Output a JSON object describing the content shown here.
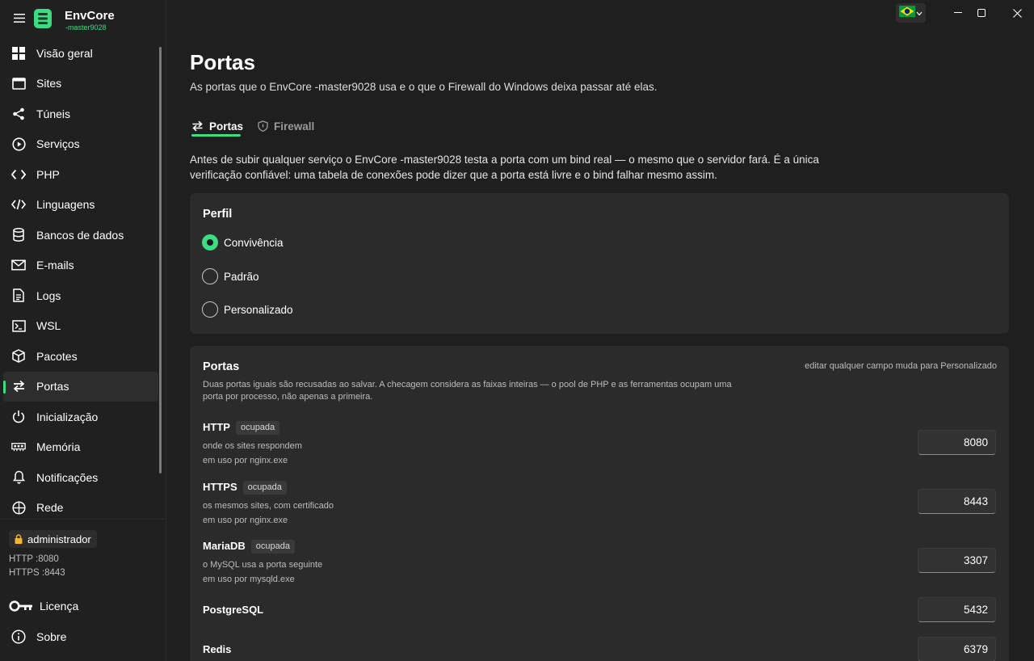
{
  "app": {
    "title": "EnvCore",
    "subtitle": "-master9028",
    "accent": "#3ddc84"
  },
  "sidebar": {
    "items": [
      {
        "label": "Visão geral",
        "icon": "grid-icon"
      },
      {
        "label": "Sites",
        "icon": "browser-window-icon"
      },
      {
        "label": "Túneis",
        "icon": "share-icon"
      },
      {
        "label": "Serviços",
        "icon": "play-circle-icon"
      },
      {
        "label": "PHP",
        "icon": "code-brackets-icon"
      },
      {
        "label": "Linguagens",
        "icon": "code-slash-icon"
      },
      {
        "label": "Bancos de dados",
        "icon": "database-icon"
      },
      {
        "label": "E-mails",
        "icon": "mail-icon"
      },
      {
        "label": "Logs",
        "icon": "document-icon"
      },
      {
        "label": "WSL",
        "icon": "terminal-icon"
      },
      {
        "label": "Pacotes",
        "icon": "package-icon"
      },
      {
        "label": "Portas",
        "icon": "swap-arrows-icon",
        "active": true
      },
      {
        "label": "Inicialização",
        "icon": "power-icon"
      },
      {
        "label": "Memória",
        "icon": "memory-icon"
      },
      {
        "label": "Notificações",
        "icon": "bell-icon"
      },
      {
        "label": "Rede",
        "icon": "globe-icon"
      }
    ],
    "user_badge": "administrador",
    "http_status": "HTTP :8080",
    "https_status": "HTTPS :8443",
    "license_label": "Licença",
    "about_label": "Sobre"
  },
  "page": {
    "title": "Portas",
    "subtitle": "As portas que o EnvCore -master9028 usa e o que o Firewall do Windows deixa passar até elas.",
    "tabs": [
      {
        "label": "Portas",
        "icon": "swap-arrows-icon",
        "active": true
      },
      {
        "label": "Firewall",
        "icon": "shield-icon",
        "active": false
      }
    ],
    "intro": "Antes de subir qualquer serviço o EnvCore -master9028 testa a porta com um bind real — o mesmo que o servidor fará. É a única verificação confiável: uma tabela de conexões pode dizer que a porta está livre e o bind falhar mesmo assim."
  },
  "profile": {
    "title": "Perfil",
    "options": [
      {
        "label": "Conviνência",
        "checked": true
      },
      {
        "label": "Padrão",
        "checked": false
      },
      {
        "label": "Personalizado",
        "checked": false
      }
    ]
  },
  "ports": {
    "title": "Portas",
    "note": "editar qualquer campo muda para Personalizado",
    "description": "Duas portas iguais são recusadas ao salvar. A checagem considera as faixas inteiras — o pool de PHP e as ferramentas ocupam uma porta por processo, não apenas a primeira.",
    "rows": [
      {
        "name": "HTTP",
        "tag": "ocupada",
        "desc": "onde os sites respondem",
        "use": "em uso por nginx.exe",
        "value": "8080"
      },
      {
        "name": "HTTPS",
        "tag": "ocupada",
        "desc": "os mesmos sites, com certificado",
        "use": "em uso por nginx.exe",
        "value": "8443"
      },
      {
        "name": "MariaDB",
        "tag": "ocupada",
        "desc": "o MySQL usa a porta seguinte",
        "use": "em uso por mysqld.exe",
        "value": "3307"
      },
      {
        "name": "PostgreSQL",
        "value": "5432"
      },
      {
        "name": "Redis",
        "value": "6379"
      }
    ]
  }
}
